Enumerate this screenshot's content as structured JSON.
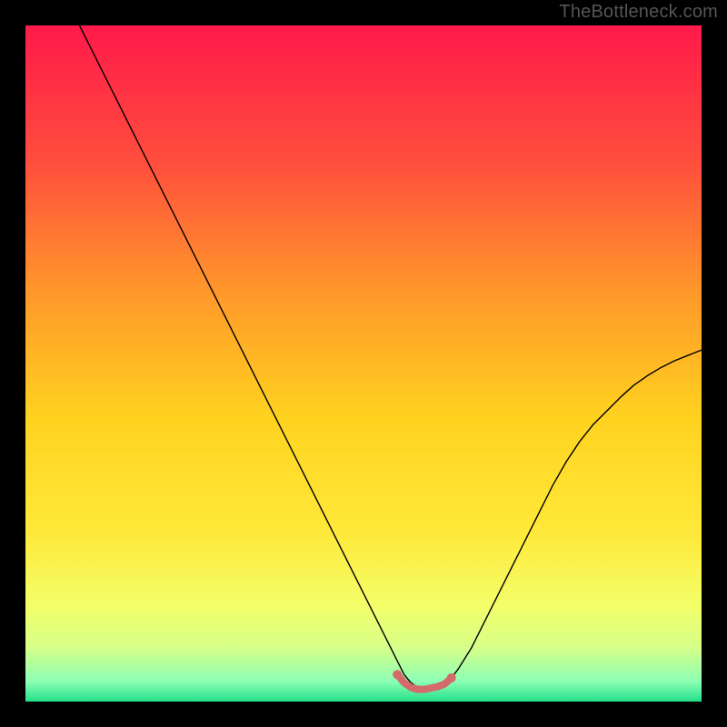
{
  "watermark": "TheBottleneck.com",
  "chart_data": {
    "type": "line",
    "title": "",
    "xlabel": "",
    "ylabel": "",
    "xlim": [
      0,
      100
    ],
    "ylim": [
      0,
      100
    ],
    "gradient_stops": [
      {
        "pos": 0.0,
        "color": "#ff1a4a"
      },
      {
        "pos": 0.2,
        "color": "#ff4d3d"
      },
      {
        "pos": 0.4,
        "color": "#ff9a2a"
      },
      {
        "pos": 0.58,
        "color": "#ffd21f"
      },
      {
        "pos": 0.75,
        "color": "#ffe93a"
      },
      {
        "pos": 0.86,
        "color": "#f3ff6a"
      },
      {
        "pos": 0.92,
        "color": "#d6ff88"
      },
      {
        "pos": 0.97,
        "color": "#8dffb4"
      },
      {
        "pos": 1.0,
        "color": "#22e08a"
      }
    ],
    "series": [
      {
        "name": "bottleneck-curve",
        "color": "#000000",
        "width": 1.4,
        "x": [
          8,
          10,
          12,
          14,
          16,
          18,
          20,
          22,
          24,
          26,
          28,
          30,
          32,
          34,
          36,
          38,
          40,
          42,
          44,
          46,
          48,
          50,
          52,
          54,
          55,
          56,
          57,
          58,
          59,
          60,
          61,
          62,
          63,
          64,
          66,
          68,
          70,
          72,
          74,
          76,
          78,
          80,
          82,
          84,
          86,
          88,
          90,
          92,
          94,
          96,
          98,
          100
        ],
        "y": [
          100,
          96,
          92,
          88,
          84,
          80,
          76,
          72,
          68,
          64,
          60,
          56,
          52,
          48,
          44,
          40,
          36,
          32,
          28,
          24,
          20,
          16,
          12,
          8,
          6,
          4,
          2.8,
          2.1,
          1.8,
          1.8,
          2,
          2.6,
          3.5,
          4.8,
          8,
          12,
          16,
          20,
          24,
          28,
          32,
          35.5,
          38.5,
          41,
          43,
          45,
          46.8,
          48.2,
          49.4,
          50.4,
          51.2,
          52
        ]
      }
    ],
    "highlight_band": {
      "name": "optimal-range",
      "color": "#d46a6a",
      "width": 8,
      "x": [
        55,
        56,
        57,
        58,
        59,
        60,
        61,
        62,
        63
      ],
      "y": [
        4,
        2.8,
        2.1,
        1.8,
        1.8,
        2,
        2.2,
        2.6,
        3.5
      ]
    }
  }
}
